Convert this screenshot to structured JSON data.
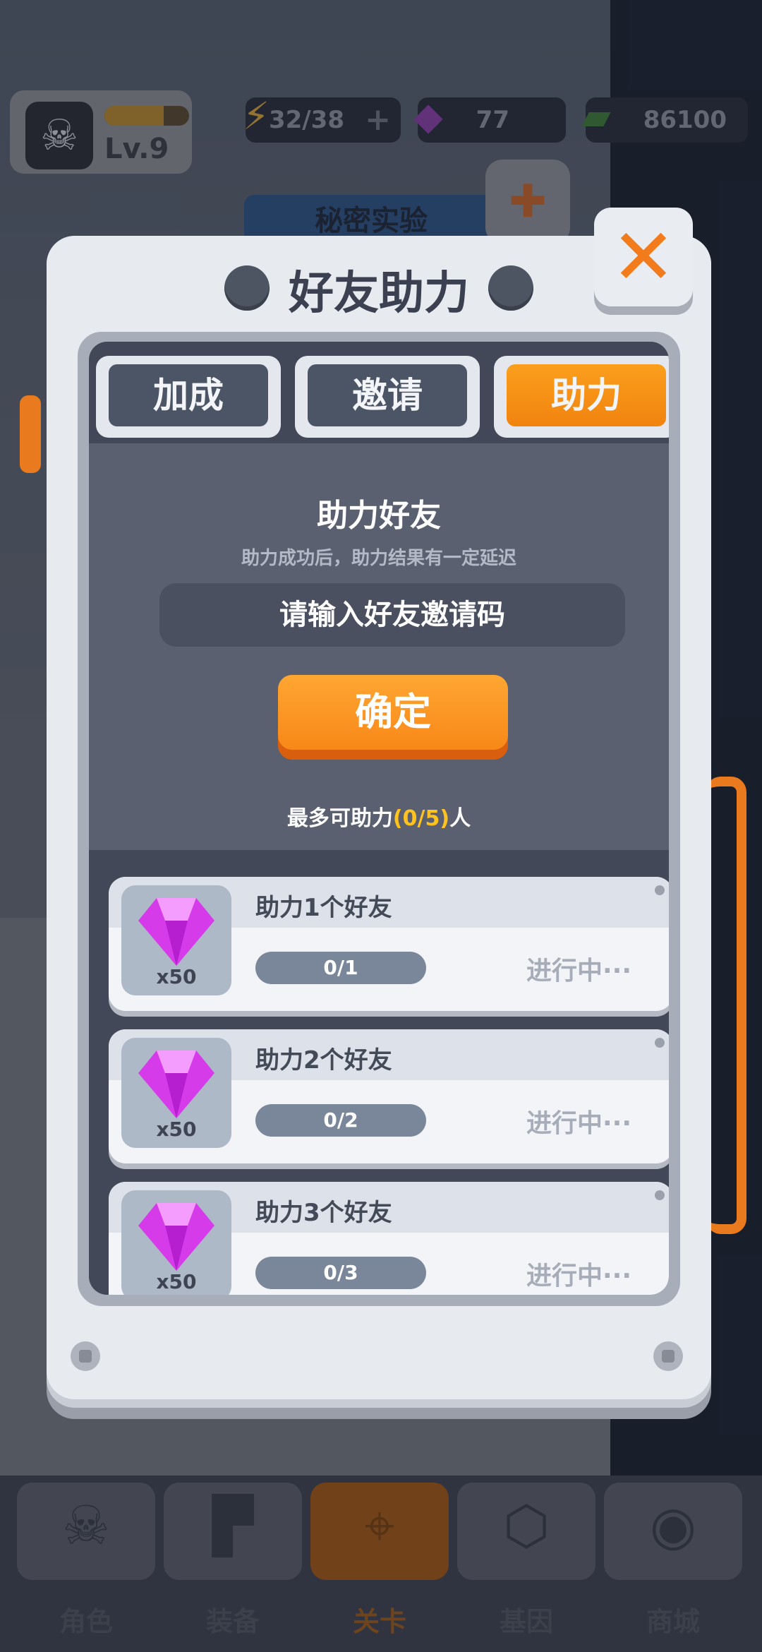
{
  "hud": {
    "level": "Lv.9",
    "energy": "32/38",
    "gems": "77",
    "cash": "86100",
    "xp_fraction": 0.7,
    "lab_banner": "秘密实验"
  },
  "modal": {
    "title": "好友助力",
    "tabs": [
      {
        "label": "加成",
        "active": false
      },
      {
        "label": "邀请",
        "active": false
      },
      {
        "label": "助力",
        "active": true
      }
    ],
    "section_title": "助力好友",
    "section_desc": "助力成功后，助力结果有一定延迟",
    "code_placeholder": "请输入好友邀请码",
    "confirm_label": "确定",
    "limit_prefix": "最多可助力",
    "limit_value": "(0/5)",
    "limit_suffix": "人",
    "tasks": [
      {
        "name": "助力1个好友",
        "reward": "x50",
        "progress": "0/1",
        "fraction": 0,
        "status": "进行中···"
      },
      {
        "name": "助力2个好友",
        "reward": "x50",
        "progress": "0/2",
        "fraction": 0,
        "status": "进行中···"
      },
      {
        "name": "助力3个好友",
        "reward": "x50",
        "progress": "0/3",
        "fraction": 0,
        "status": "进行中···"
      }
    ]
  },
  "nav": [
    {
      "label": "角色",
      "icon": "skull-icon",
      "active": false
    },
    {
      "label": "装备",
      "icon": "gun-icon",
      "active": false
    },
    {
      "label": "关卡",
      "icon": "map-pin-icon",
      "active": true
    },
    {
      "label": "基因",
      "icon": "hexagon-icon",
      "active": false
    },
    {
      "label": "商城",
      "icon": "shop-icon",
      "active": false
    }
  ],
  "colors": {
    "accent": "#f7891a",
    "highlight": "#ffc21e",
    "panel_dark": "#424858",
    "gem": "#d63bea"
  }
}
